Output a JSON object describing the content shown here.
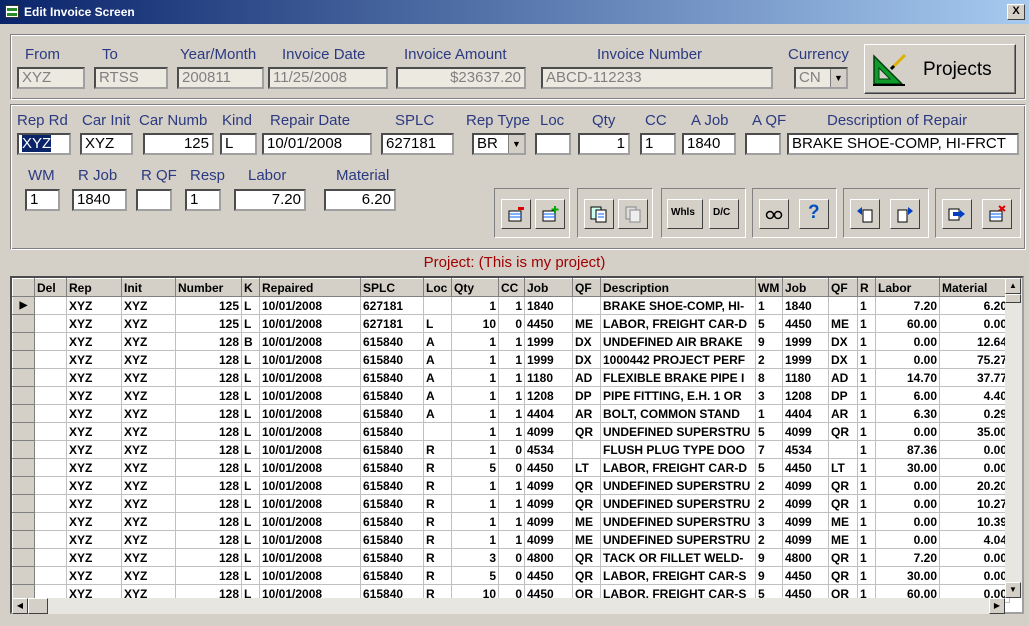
{
  "window": {
    "title": "Edit Invoice Screen",
    "close": "X"
  },
  "header": {
    "labels": {
      "from": "From",
      "to": "To",
      "year_month": "Year/Month",
      "invoice_date": "Invoice Date",
      "invoice_amount": "Invoice Amount",
      "invoice_number": "Invoice Number",
      "currency": "Currency"
    },
    "values": {
      "from": "XYZ",
      "to": "RTSS",
      "year_month": "200811",
      "invoice_date": "11/25/2008",
      "invoice_amount": "$23637.20",
      "invoice_number": "ABCD-112233",
      "currency": "CN"
    },
    "projects_button": "Projects"
  },
  "repair": {
    "labels": {
      "rep_rd": "Rep Rd",
      "car_init": "Car Init",
      "car_numb": "Car Numb",
      "kind": "Kind",
      "repair_date": "Repair Date",
      "splc": "SPLC",
      "rep_type": "Rep Type",
      "loc": "Loc",
      "qty": "Qty",
      "cc": "CC",
      "a_job": "A Job",
      "a_qf": "A QF",
      "description": "Description of Repair",
      "wm": "WM",
      "r_job": "R Job",
      "r_qf": "R QF",
      "resp": "Resp",
      "labor": "Labor",
      "material": "Material"
    },
    "values": {
      "rep_rd": "XYZ",
      "car_init": "XYZ",
      "car_numb": "125",
      "kind": "L",
      "repair_date": "10/01/2008",
      "splc": "627181",
      "rep_type": "BR",
      "loc": "",
      "qty": "1",
      "cc": "1",
      "a_job": "1840",
      "a_qf": "",
      "description": "BRAKE SHOE-COMP, HI-FRCT",
      "wm": "1",
      "r_job": "1840",
      "r_qf": "",
      "resp": "1",
      "labor": "7.20",
      "material": "6.20"
    }
  },
  "toolbar": {
    "whls": "Whls",
    "dc": "D/C",
    "help": "?"
  },
  "project_label": "Project: (This is my project)",
  "grid": {
    "columns": [
      "Del",
      "Rep",
      "Init",
      "Number",
      "K",
      "Repaired",
      "SPLC",
      "Loc",
      "Qty",
      "CC",
      "Job",
      "QF",
      "Description",
      "WM",
      "Job",
      "QF",
      "R",
      "Labor",
      "Material"
    ],
    "current_marker": "▶",
    "rows": [
      [
        "",
        "XYZ",
        "XYZ",
        "125",
        "L",
        "10/01/2008",
        "627181",
        "",
        "1",
        "1",
        "1840",
        "",
        "BRAKE SHOE-COMP, HI-",
        "1",
        "1840",
        "",
        "1",
        "7.20",
        "6.20"
      ],
      [
        "",
        "XYZ",
        "XYZ",
        "125",
        "L",
        "10/01/2008",
        "627181",
        "L",
        "10",
        "0",
        "4450",
        "ME",
        "LABOR, FREIGHT CAR-D",
        "5",
        "4450",
        "ME",
        "1",
        "60.00",
        "0.00"
      ],
      [
        "",
        "XYZ",
        "XYZ",
        "128",
        "B",
        "10/01/2008",
        "615840",
        "A",
        "1",
        "1",
        "1999",
        "DX",
        "UNDEFINED AIR BRAKE",
        "9",
        "1999",
        "DX",
        "1",
        "0.00",
        "12.64"
      ],
      [
        "",
        "XYZ",
        "XYZ",
        "128",
        "L",
        "10/01/2008",
        "615840",
        "A",
        "1",
        "1",
        "1999",
        "DX",
        "1000442 PROJECT PERF",
        "2",
        "1999",
        "DX",
        "1",
        "0.00",
        "75.27"
      ],
      [
        "",
        "XYZ",
        "XYZ",
        "128",
        "L",
        "10/01/2008",
        "615840",
        "A",
        "1",
        "1",
        "1180",
        "AD",
        "FLEXIBLE BRAKE PIPE I",
        "8",
        "1180",
        "AD",
        "1",
        "14.70",
        "37.77"
      ],
      [
        "",
        "XYZ",
        "XYZ",
        "128",
        "L",
        "10/01/2008",
        "615840",
        "A",
        "1",
        "1",
        "1208",
        "DP",
        "PIPE FITTING, E.H. 1 OR",
        "3",
        "1208",
        "DP",
        "1",
        "6.00",
        "4.40"
      ],
      [
        "",
        "XYZ",
        "XYZ",
        "128",
        "L",
        "10/01/2008",
        "615840",
        "A",
        "1",
        "1",
        "4404",
        "AR",
        "BOLT, COMMON STAND",
        "1",
        "4404",
        "AR",
        "1",
        "6.30",
        "0.29"
      ],
      [
        "",
        "XYZ",
        "XYZ",
        "128",
        "L",
        "10/01/2008",
        "615840",
        "",
        "1",
        "1",
        "4099",
        "QR",
        "UNDEFINED SUPERSTRU",
        "5",
        "4099",
        "QR",
        "1",
        "0.00",
        "35.00"
      ],
      [
        "",
        "XYZ",
        "XYZ",
        "128",
        "L",
        "10/01/2008",
        "615840",
        "R",
        "1",
        "0",
        "4534",
        "",
        "FLUSH PLUG TYPE DOO",
        "7",
        "4534",
        "",
        "1",
        "87.36",
        "0.00"
      ],
      [
        "",
        "XYZ",
        "XYZ",
        "128",
        "L",
        "10/01/2008",
        "615840",
        "R",
        "5",
        "0",
        "4450",
        "LT",
        "LABOR, FREIGHT CAR-D",
        "5",
        "4450",
        "LT",
        "1",
        "30.00",
        "0.00"
      ],
      [
        "",
        "XYZ",
        "XYZ",
        "128",
        "L",
        "10/01/2008",
        "615840",
        "R",
        "1",
        "1",
        "4099",
        "QR",
        "UNDEFINED SUPERSTRU",
        "2",
        "4099",
        "QR",
        "1",
        "0.00",
        "20.20"
      ],
      [
        "",
        "XYZ",
        "XYZ",
        "128",
        "L",
        "10/01/2008",
        "615840",
        "R",
        "1",
        "1",
        "4099",
        "QR",
        "UNDEFINED SUPERSTRU",
        "2",
        "4099",
        "QR",
        "1",
        "0.00",
        "10.27"
      ],
      [
        "",
        "XYZ",
        "XYZ",
        "128",
        "L",
        "10/01/2008",
        "615840",
        "R",
        "1",
        "1",
        "4099",
        "ME",
        "UNDEFINED SUPERSTRU",
        "3",
        "4099",
        "ME",
        "1",
        "0.00",
        "10.39"
      ],
      [
        "",
        "XYZ",
        "XYZ",
        "128",
        "L",
        "10/01/2008",
        "615840",
        "R",
        "1",
        "1",
        "4099",
        "ME",
        "UNDEFINED SUPERSTRU",
        "2",
        "4099",
        "ME",
        "1",
        "0.00",
        "4.04"
      ],
      [
        "",
        "XYZ",
        "XYZ",
        "128",
        "L",
        "10/01/2008",
        "615840",
        "R",
        "3",
        "0",
        "4800",
        "QR",
        "TACK OR FILLET WELD-",
        "9",
        "4800",
        "QR",
        "1",
        "7.20",
        "0.00"
      ],
      [
        "",
        "XYZ",
        "XYZ",
        "128",
        "L",
        "10/01/2008",
        "615840",
        "R",
        "5",
        "0",
        "4450",
        "QR",
        "LABOR, FREIGHT CAR-S",
        "9",
        "4450",
        "QR",
        "1",
        "30.00",
        "0.00"
      ],
      [
        "",
        "XYZ",
        "XYZ",
        "128",
        "L",
        "10/01/2008",
        "615840",
        "R",
        "10",
        "0",
        "4450",
        "QR",
        "LABOR, FREIGHT CAR-S",
        "5",
        "4450",
        "QR",
        "1",
        "60.00",
        "0.00"
      ]
    ]
  }
}
